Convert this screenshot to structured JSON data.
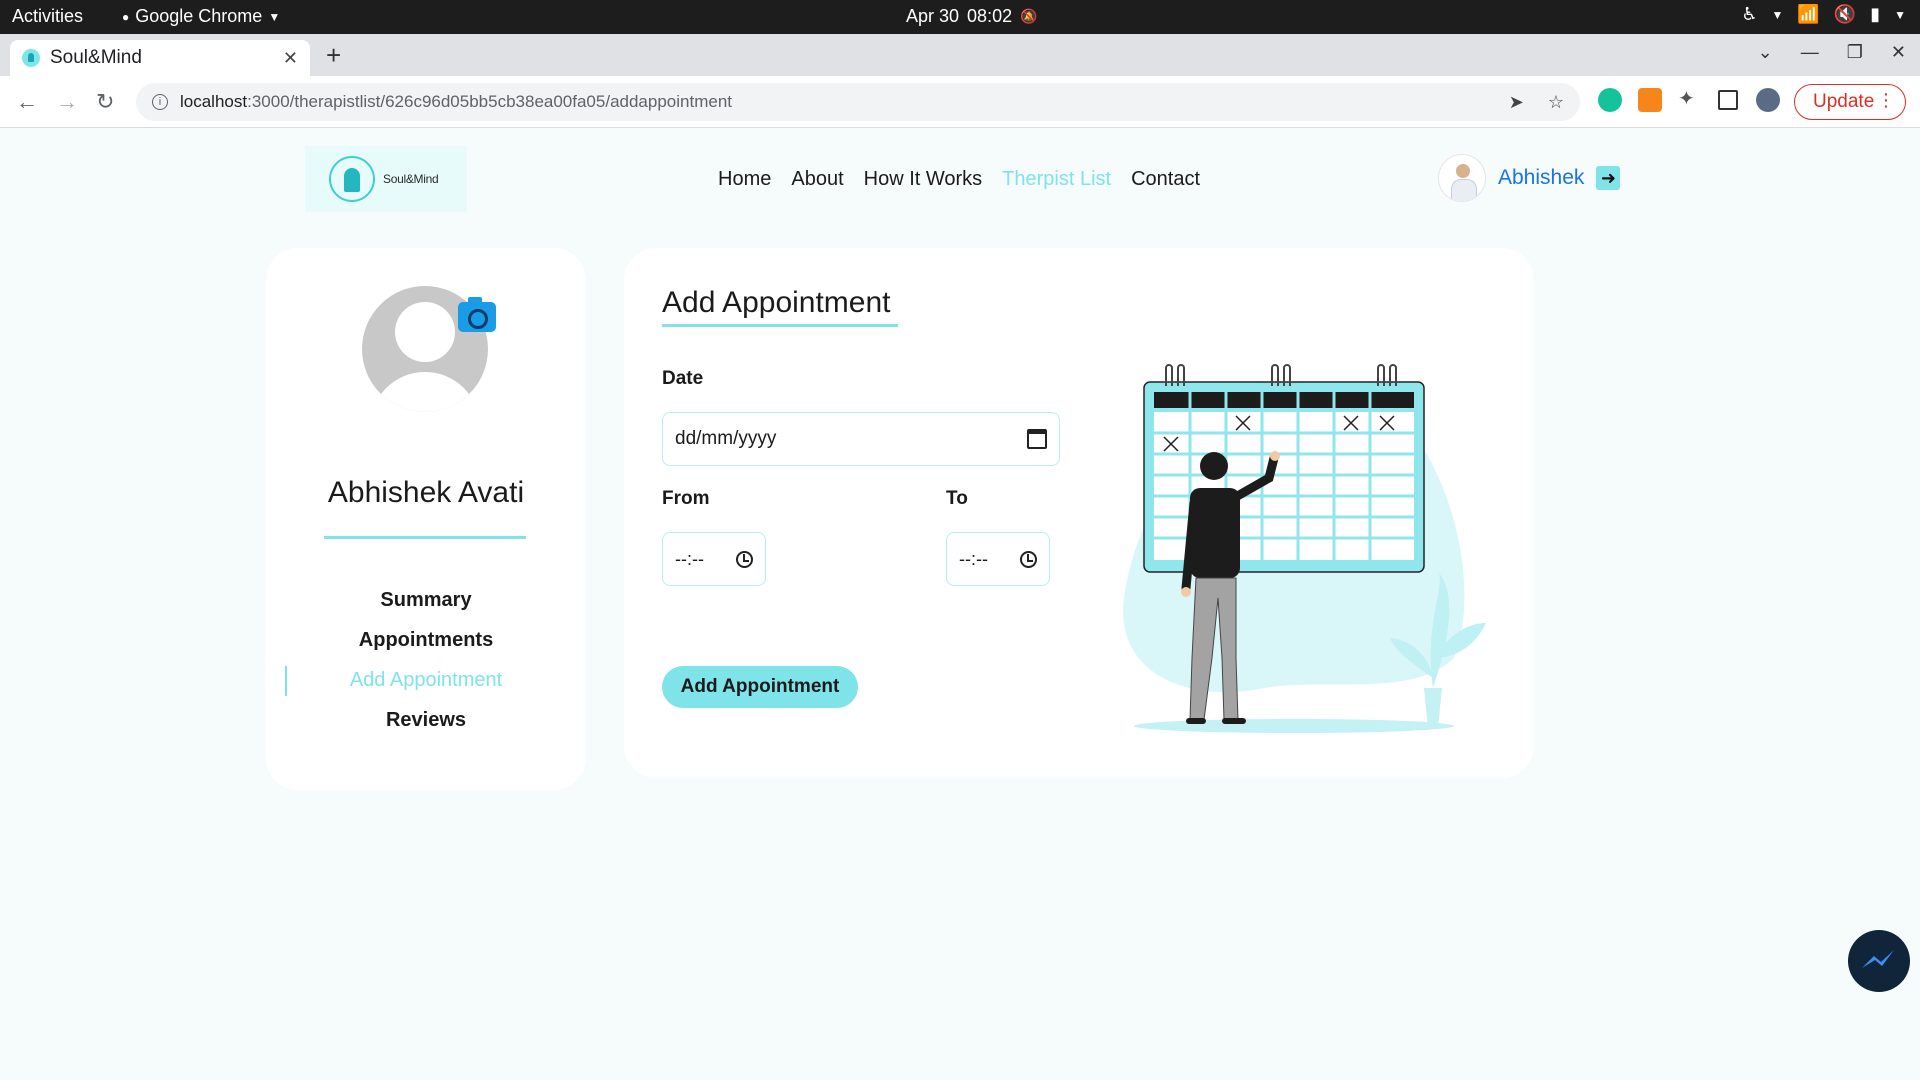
{
  "os_bar": {
    "activities": "Activities",
    "app_name": "Google Chrome",
    "date": "Apr 30",
    "time": "08:02"
  },
  "browser": {
    "tab_title": "Soul&Mind",
    "url_host": "localhost",
    "url_path": ":3000/therapistlist/626c96d05bb5cb38ea00fa05/addappointment",
    "update_label": "Update"
  },
  "site": {
    "logo_text": "Soul&Mind",
    "nav": [
      "Home",
      "About",
      "How It Works",
      "Therpist List",
      "Contact"
    ],
    "active_nav_index": 3,
    "user_name": "Abhishek"
  },
  "profile": {
    "name": "Abhishek Avati",
    "menu": [
      "Summary",
      "Appointments",
      "Add Appointment",
      "Reviews"
    ],
    "active_menu_index": 2
  },
  "form": {
    "title": "Add Appointment",
    "date_label": "Date",
    "date_placeholder": "dd/mm/yyyy",
    "from_label": "From",
    "to_label": "To",
    "from_value": "--:--",
    "to_value": "--:--",
    "submit_label": "Add Appointment"
  },
  "colors": {
    "accent": "#7fe3ea",
    "link_blue": "#1a73e8",
    "update_red": "#d93025"
  }
}
